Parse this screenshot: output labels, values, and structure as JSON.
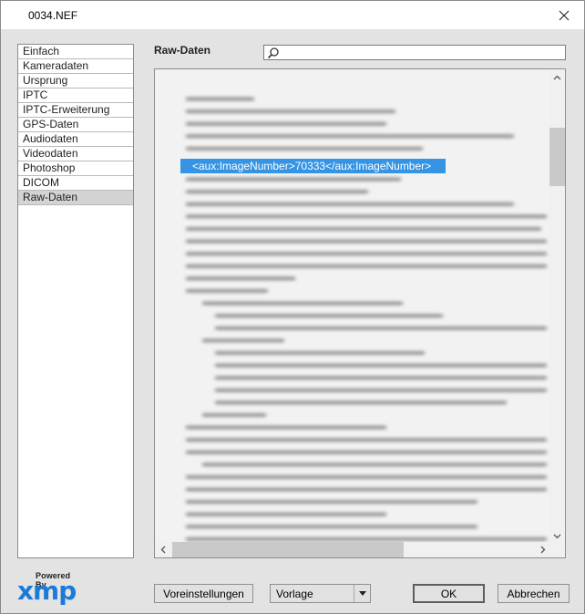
{
  "window": {
    "title": "0034.NEF",
    "close_icon": "close-icon"
  },
  "sidebar": {
    "items": [
      {
        "label": "Einfach",
        "selected": false
      },
      {
        "label": "Kameradaten",
        "selected": false
      },
      {
        "label": "Ursprung",
        "selected": false
      },
      {
        "label": "IPTC",
        "selected": false
      },
      {
        "label": "IPTC-Erweiterung",
        "selected": false
      },
      {
        "label": "GPS-Daten",
        "selected": false
      },
      {
        "label": "Audiodaten",
        "selected": false
      },
      {
        "label": "Videodaten",
        "selected": false
      },
      {
        "label": "Photoshop",
        "selected": false
      },
      {
        "label": "DICOM",
        "selected": false
      },
      {
        "label": "Raw-Daten",
        "selected": true
      }
    ]
  },
  "main": {
    "section_title": "Raw-Daten",
    "search": {
      "value": "",
      "placeholder": "",
      "icon": "search-icon"
    },
    "raw_text": {
      "highlighted_line": "<aux:ImageNumber>70333</aux:ImageNumber>",
      "other_lines_blurred": true
    }
  },
  "footer": {
    "logo": {
      "powered_by": "Powered By",
      "brand": "xmp"
    },
    "presets_label": "Voreinstellungen",
    "template_select": {
      "selected": "Vorlage"
    },
    "ok_label": "OK",
    "cancel_label": "Abbrechen"
  },
  "colors": {
    "selection": "#3594e4",
    "brand_blue": "#1b7bd8",
    "dialog_bg": "#e3e3e3"
  }
}
